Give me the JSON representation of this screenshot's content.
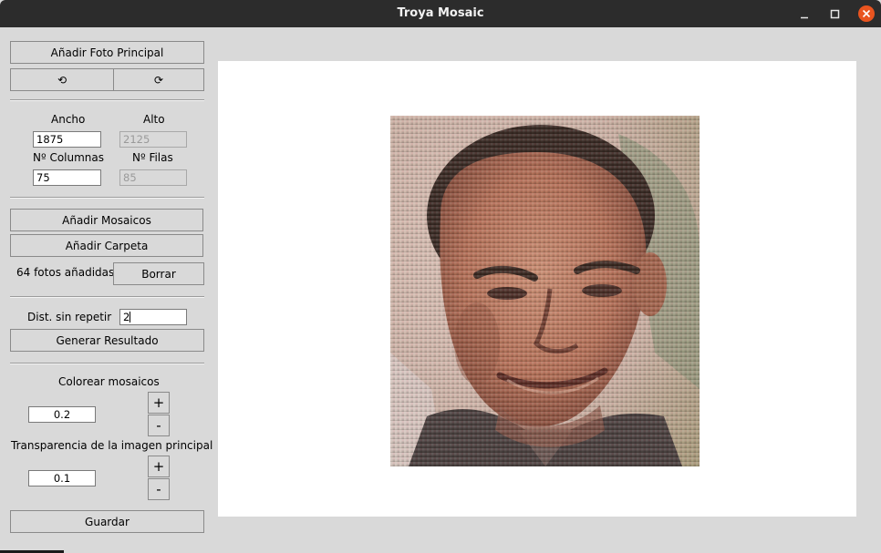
{
  "window": {
    "title": "Troya Mosaic",
    "minimize_icon": "minimize-icon",
    "maximize_icon": "maximize-icon",
    "close_icon": "close-icon",
    "close_color": "#e9541f"
  },
  "sidebar": {
    "add_main_photo": "Añadir Foto Principal",
    "rotate_left": "⟲",
    "rotate_right": "⟳",
    "width_label": "Ancho",
    "height_label": "Alto",
    "width_value": "1875",
    "height_value": "2125",
    "columns_label": "Nº Columnas",
    "rows_label": "Nº Filas",
    "columns_value": "75",
    "rows_value": "85",
    "add_mosaics": "Añadir Mosaicos",
    "add_folder": "Añadir Carpeta",
    "photos_added": "64 fotos añadidas",
    "delete": "Borrar",
    "dist_label": "Dist. sin repetir",
    "dist_value": "2",
    "generate": "Generar Resultado",
    "colorize_label": "Colorear mosaicos",
    "colorize_value": "0.2",
    "plus": "+",
    "minus": "-",
    "transparency_label": "Transparencia de la imagen principal",
    "transparency_value": "0.1",
    "save": "Guardar"
  },
  "canvas": {
    "image": "mosaic-portrait"
  }
}
